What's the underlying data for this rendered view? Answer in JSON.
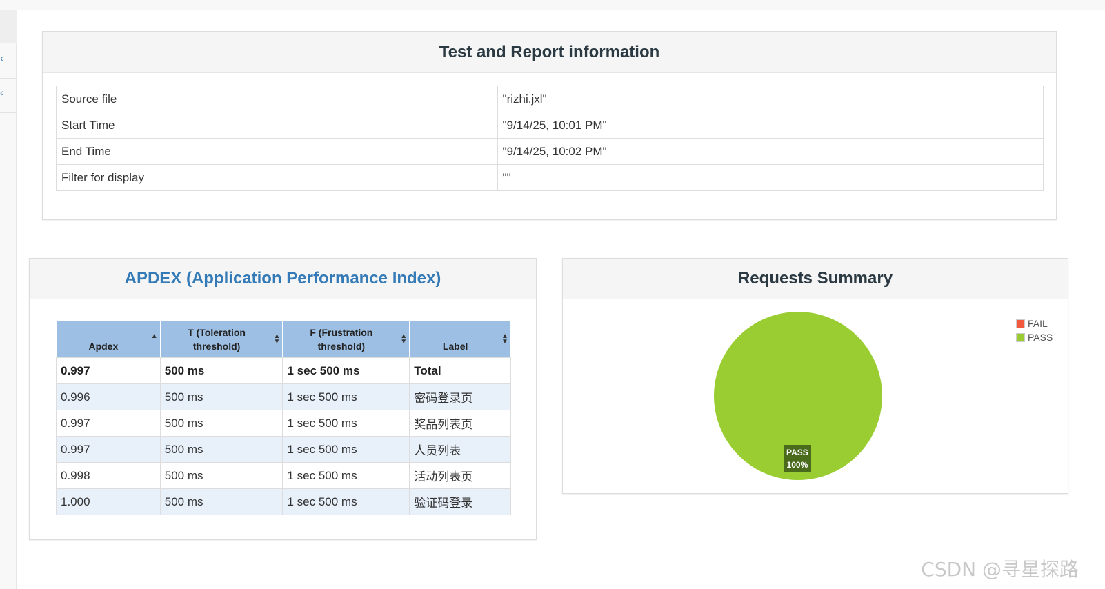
{
  "info_panel": {
    "title": "Test and Report information",
    "rows": [
      {
        "key": "Source file",
        "value": "\"rizhi.jxl\""
      },
      {
        "key": "Start Time",
        "value": "\"9/14/25, 10:01 PM\""
      },
      {
        "key": "End Time",
        "value": "\"9/14/25, 10:02 PM\""
      },
      {
        "key": "Filter for display",
        "value": "\"\""
      }
    ]
  },
  "apdex_panel": {
    "title": "APDEX (Application Performance Index)",
    "columns": [
      "Apdex",
      "T (Toleration threshold)",
      "F (Frustration threshold)",
      "Label"
    ],
    "rows": [
      {
        "apdex": "0.997",
        "t": "500 ms",
        "f": "1 sec 500 ms",
        "label": "Total"
      },
      {
        "apdex": "0.996",
        "t": "500 ms",
        "f": "1 sec 500 ms",
        "label": "密码登录页"
      },
      {
        "apdex": "0.997",
        "t": "500 ms",
        "f": "1 sec 500 ms",
        "label": "奖品列表页"
      },
      {
        "apdex": "0.997",
        "t": "500 ms",
        "f": "1 sec 500 ms",
        "label": "人员列表"
      },
      {
        "apdex": "0.998",
        "t": "500 ms",
        "f": "1 sec 500 ms",
        "label": "活动列表页"
      },
      {
        "apdex": "1.000",
        "t": "500 ms",
        "f": "1 sec 500 ms",
        "label": "验证码登录"
      }
    ]
  },
  "summary_panel": {
    "title": "Requests Summary",
    "legend": [
      {
        "name": "FAIL",
        "color": "#f2593e"
      },
      {
        "name": "PASS",
        "color": "#9acd32"
      }
    ],
    "slice_label": "PASS",
    "slice_percent": "100%"
  },
  "chart_data": {
    "type": "pie",
    "title": "",
    "categories": [
      "FAIL",
      "PASS"
    ],
    "values": [
      0,
      100
    ],
    "colors": [
      "#f2593e",
      "#9acd32"
    ],
    "legend": "top-right"
  },
  "watermark": "CSDN @寻星探路"
}
